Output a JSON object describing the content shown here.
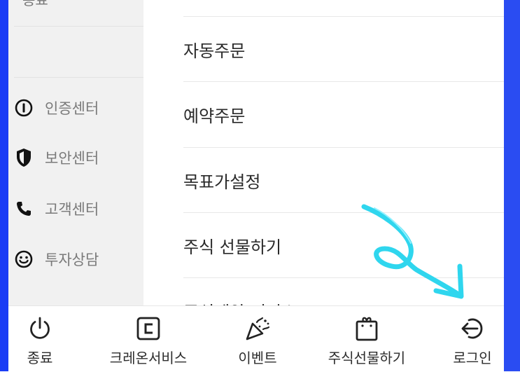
{
  "sidebar": {
    "partial_item": "종료",
    "items": [
      {
        "label": "인증센터",
        "icon": "info-circle-icon"
      },
      {
        "label": "보안센터",
        "icon": "shield-icon"
      },
      {
        "label": "고객센터",
        "icon": "phone-icon"
      },
      {
        "label": "투자상담",
        "icon": "smiley-icon"
      }
    ]
  },
  "menu": {
    "items": [
      {
        "label": "자동주문"
      },
      {
        "label": "예약주문"
      },
      {
        "label": "목표가설정"
      },
      {
        "label": "주식 선물하기"
      },
      {
        "label": "주식계약 서비스"
      }
    ]
  },
  "bottom_bar": {
    "tabs": [
      {
        "label": "종료",
        "icon": "power-icon"
      },
      {
        "label": "크레온서비스",
        "icon": "creon-c-icon"
      },
      {
        "label": "이벤트",
        "icon": "party-popper-icon"
      },
      {
        "label": "주식선물하기",
        "icon": "gift-bag-icon"
      },
      {
        "label": "로그인",
        "icon": "login-arrow-icon"
      }
    ]
  },
  "colors": {
    "accent_blue": "#1a3cf5",
    "annotation_cyan": "#2fd6ee",
    "text_dark": "#2a2a2a",
    "text_muted": "#7a7a7a",
    "sidebar_bg": "#f1f1f1"
  }
}
